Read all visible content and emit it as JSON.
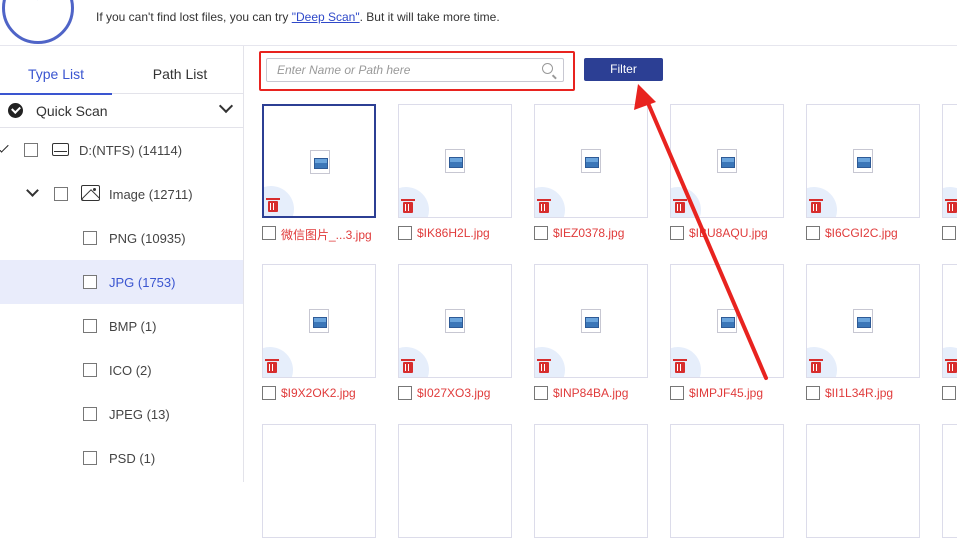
{
  "topbar": {
    "hint_before": "If you can't find lost files, you can try ",
    "hint_link": "\"Deep Scan\"",
    "hint_after": ". But it will take more time."
  },
  "sidebar": {
    "tabs": [
      "Type List",
      "Path List"
    ],
    "quick_scan": "Quick Scan",
    "tree": [
      {
        "label": "D:(NTFS) (14114)"
      },
      {
        "label": "Image (12711)"
      },
      {
        "label": "PNG (10935)"
      },
      {
        "label": "JPG (1753)"
      },
      {
        "label": "BMP (1)"
      },
      {
        "label": "ICO (2)"
      },
      {
        "label": "JPEG (13)"
      },
      {
        "label": "PSD (1)"
      }
    ]
  },
  "toolbar": {
    "search_placeholder": "Enter Name or Path here",
    "filter_label": "Filter"
  },
  "files": {
    "row1": [
      "微信图片_...3.jpg",
      "$IK86H2L.jpg",
      "$IEZ0378.jpg",
      "$IBU8AQU.jpg",
      "$I6CGI2C.jpg"
    ],
    "row2": [
      "$I9X2OK2.jpg",
      "$I027XO3.jpg",
      "$INP84BA.jpg",
      "$IMPJF45.jpg",
      "$II1L34R.jpg"
    ]
  },
  "colors": {
    "accent": "#3a55d0",
    "button": "#2c3f94",
    "highlight": "#e8231f",
    "filename": "#e03b3b"
  }
}
